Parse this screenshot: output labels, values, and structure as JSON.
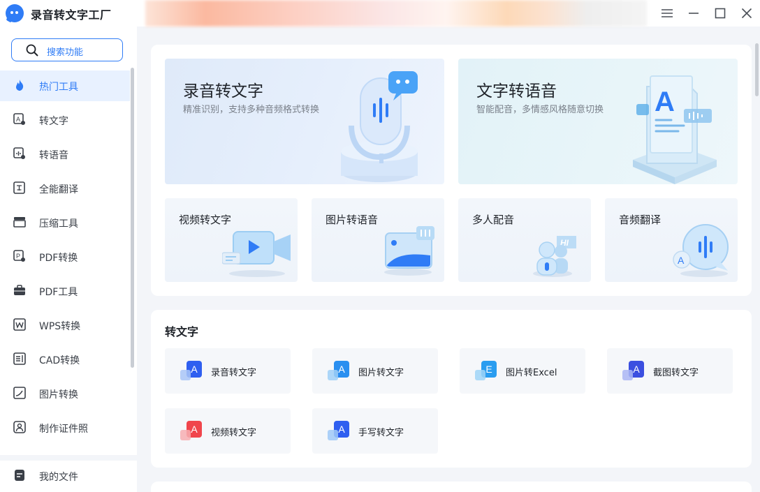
{
  "app": {
    "title": "录音转文字工厂"
  },
  "window_controls": [
    "menu-icon",
    "minimize-icon",
    "maximize-icon",
    "close-icon"
  ],
  "sidebar": {
    "search_label": "搜索功能",
    "items": [
      {
        "label": "热门工具",
        "icon": "flame-icon",
        "active": true
      },
      {
        "label": "转文字",
        "icon": "to-text-icon"
      },
      {
        "label": "转语音",
        "icon": "to-speech-icon"
      },
      {
        "label": "全能翻译",
        "icon": "translate-icon"
      },
      {
        "label": "压缩工具",
        "icon": "compress-icon"
      },
      {
        "label": "PDF转换",
        "icon": "pdf-convert-icon"
      },
      {
        "label": "PDF工具",
        "icon": "briefcase-icon"
      },
      {
        "label": "WPS转换",
        "icon": "wps-icon"
      },
      {
        "label": "CAD转换",
        "icon": "cad-icon"
      },
      {
        "label": "图片转换",
        "icon": "image-convert-icon"
      },
      {
        "label": "制作证件照",
        "icon": "id-photo-icon"
      }
    ],
    "footer": {
      "label": "我的文件",
      "icon": "file-icon"
    }
  },
  "hot": {
    "big": [
      {
        "title": "录音转文字",
        "subtitle": "精准识别，支持多种音频格式转换",
        "icon": "microphone-icon"
      },
      {
        "title": "文字转语音",
        "subtitle": "智能配音，多情感风格随意切换",
        "icon": "document-a-icon"
      }
    ],
    "small": [
      {
        "title": "视频转文字",
        "icon": "video-camera-icon"
      },
      {
        "title": "图片转语音",
        "icon": "image-audio-icon"
      },
      {
        "title": "多人配音",
        "icon": "people-hi-icon"
      },
      {
        "title": "音频翻译",
        "icon": "audio-translate-icon"
      }
    ]
  },
  "to_text_section": {
    "title": "转文字",
    "tools": [
      {
        "label": "录音转文字",
        "glyph": "A",
        "icon": "audio-to-text-icon"
      },
      {
        "label": "图片转文字",
        "glyph": "A",
        "icon": "image-to-text-icon"
      },
      {
        "label": "图片转Excel",
        "glyph": "E",
        "icon": "image-to-excel-icon"
      },
      {
        "label": "截图转文字",
        "glyph": "A",
        "icon": "screenshot-to-text-icon"
      },
      {
        "label": "视频转文字",
        "glyph": "A",
        "icon": "video-to-text-icon"
      },
      {
        "label": "手写转文字",
        "glyph": "A",
        "icon": "handwriting-to-text-icon"
      }
    ]
  },
  "colors": {
    "accent": "#2f7cf6",
    "active_bg": "#e8f1ff",
    "page_bg": "#f3f5f9",
    "card_bg": "#f5f7fa",
    "red_tool": "#f0454c"
  }
}
